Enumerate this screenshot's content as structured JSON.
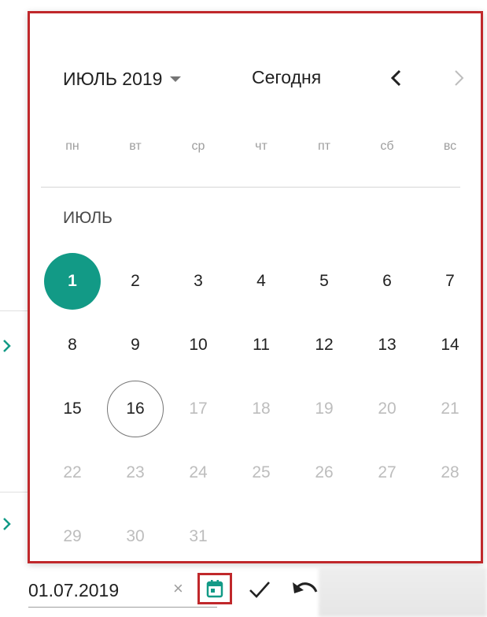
{
  "header": {
    "month_year": "ИЮЛЬ 2019",
    "today_label": "Сегодня",
    "prev_icon": "chevron-left-icon",
    "next_icon": "chevron-right-icon"
  },
  "weekdays": [
    "пн",
    "вт",
    "ср",
    "чт",
    "пт",
    "сб",
    "вс"
  ],
  "month_label": "ИЮЛЬ",
  "days": [
    [
      "1",
      "2",
      "3",
      "4",
      "5",
      "6",
      "7"
    ],
    [
      "8",
      "9",
      "10",
      "11",
      "12",
      "13",
      "14"
    ],
    [
      "15",
      "16",
      "17",
      "18",
      "19",
      "20",
      "21"
    ],
    [
      "22",
      "23",
      "24",
      "25",
      "26",
      "27",
      "28"
    ],
    [
      "29",
      "30",
      "31"
    ]
  ],
  "selected_day": "1",
  "today_day": "16",
  "input": {
    "value": "01.07.2019",
    "clear_label": "×",
    "calendar_icon": "calendar-icon",
    "confirm_icon": "check-icon",
    "undo_icon": "undo-icon"
  },
  "colors": {
    "accent": "#129a86",
    "highlight_border": "#c0282b",
    "muted_text": "#bdbdbd"
  }
}
